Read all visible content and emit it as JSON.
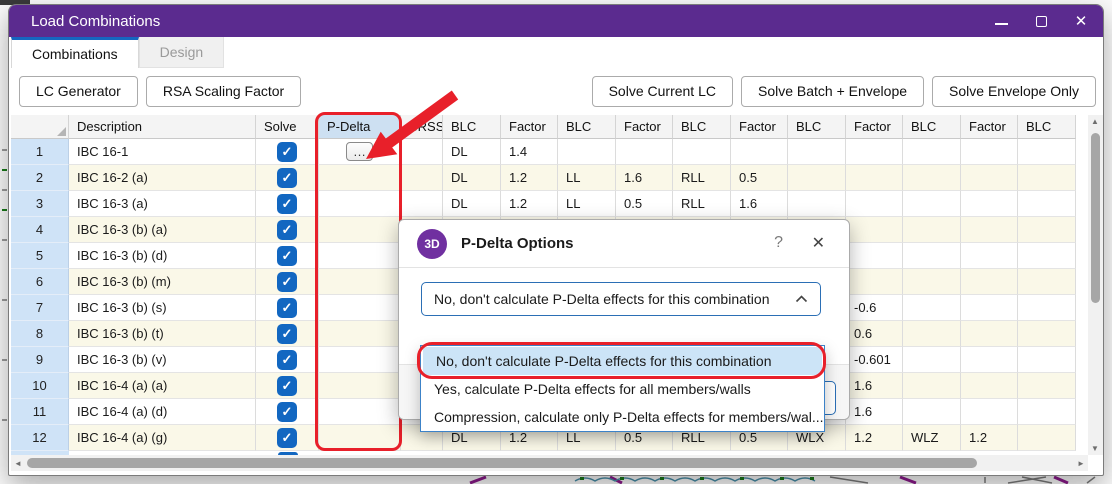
{
  "window": {
    "title": "Load Combinations"
  },
  "tabs": [
    {
      "label": "Combinations",
      "active": true
    },
    {
      "label": "Design",
      "active": false
    }
  ],
  "toolbar": {
    "left": [
      {
        "label": "LC Generator"
      },
      {
        "label": "RSA Scaling Factor"
      }
    ],
    "right": [
      {
        "label": "Solve Current LC"
      },
      {
        "label": "Solve Batch + Envelope"
      },
      {
        "label": "Solve Envelope Only"
      }
    ]
  },
  "table": {
    "headers": [
      "",
      "Description",
      "Solve",
      "P-Delta",
      "SRSS",
      "BLC",
      "Factor",
      "BLC",
      "Factor",
      "BLC",
      "Factor",
      "BLC",
      "Factor",
      "BLC",
      "Factor",
      "BLC"
    ],
    "rows": [
      {
        "num": "1",
        "description": "IBC 16-1",
        "solve": true,
        "pdelta_button": "…",
        "cells": [
          "DL",
          "1.4",
          "",
          "",
          "",
          "",
          "",
          "",
          "",
          "",
          ""
        ]
      },
      {
        "num": "2",
        "description": "IBC 16-2 (a)",
        "solve": true,
        "cells": [
          "DL",
          "1.2",
          "LL",
          "1.6",
          "RLL",
          "0.5",
          "",
          "",
          "",
          "",
          ""
        ]
      },
      {
        "num": "3",
        "description": "IBC 16-3 (a)",
        "solve": true,
        "cells": [
          "DL",
          "1.2",
          "LL",
          "0.5",
          "RLL",
          "1.6",
          "",
          "",
          "",
          "",
          ""
        ]
      },
      {
        "num": "4",
        "description": "IBC 16-3 (b) (a)",
        "solve": true,
        "cells": [
          "",
          "",
          "",
          "",
          "",
          "",
          "",
          "",
          "",
          "",
          ""
        ]
      },
      {
        "num": "5",
        "description": "IBC 16-3 (b) (d)",
        "solve": true,
        "cells": [
          "",
          "",
          "",
          "",
          "",
          "",
          "",
          "",
          "",
          "",
          ""
        ]
      },
      {
        "num": "6",
        "description": "IBC 16-3 (b) (m)",
        "solve": true,
        "cells": [
          "",
          "",
          "",
          "",
          "",
          "",
          "",
          "",
          "",
          "",
          ""
        ]
      },
      {
        "num": "7",
        "description": "IBC 16-3 (b) (s)",
        "solve": true,
        "cells": [
          "",
          "",
          "",
          "",
          "",
          "",
          "",
          "-0.6",
          "",
          "",
          ""
        ]
      },
      {
        "num": "8",
        "description": "IBC 16-3 (b) (t)",
        "solve": true,
        "cells": [
          "",
          "",
          "",
          "",
          "",
          "",
          "",
          "0.6",
          "",
          "",
          ""
        ]
      },
      {
        "num": "9",
        "description": "IBC 16-3 (b) (v)",
        "solve": true,
        "cells": [
          "",
          "",
          "",
          "",
          "",
          "",
          "",
          "-0.601",
          "",
          "",
          ""
        ]
      },
      {
        "num": "10",
        "description": "IBC 16-4 (a) (a)",
        "solve": true,
        "cells": [
          "",
          "",
          "",
          "",
          "",
          "",
          "",
          "1.6",
          "",
          "",
          ""
        ]
      },
      {
        "num": "11",
        "description": "IBC 16-4 (a) (d)",
        "solve": true,
        "cells": [
          "",
          "",
          "",
          "",
          "",
          "",
          "",
          "1.6",
          "",
          "",
          ""
        ]
      },
      {
        "num": "12",
        "description": "IBC 16-4 (a) (g)",
        "solve": true,
        "cells": [
          "DL",
          "1.2",
          "LL",
          "0.5",
          "RLL",
          "0.5",
          "WLX",
          "1.2",
          "WLZ",
          "1.2",
          ""
        ]
      }
    ]
  },
  "dialog": {
    "logo": "3D",
    "title": "P-Delta Options",
    "combobox": {
      "value": "No, don't calculate P-Delta effects for this combination"
    },
    "options": [
      {
        "label": "No, don't calculate P-Delta effects for this combination",
        "selected": true,
        "annotated": true
      },
      {
        "label": "Yes, calculate P-Delta effects for all members/walls",
        "selected": false
      },
      {
        "label": "Compression, calculate only P-Delta effects for members/wal...",
        "selected": false
      }
    ]
  },
  "icons": {
    "check": "✓",
    "ellipsis": "…",
    "close": "✕",
    "help": "?",
    "scroll_left": "◄",
    "scroll_right": "►",
    "scroll_up": "▲",
    "scroll_down": "▼"
  },
  "colors": {
    "titlebar": "#5b2b8f",
    "accent": "#1566c0",
    "checkbox": "#1267c1",
    "annotation": "#e8202a",
    "selection": "#cce4f7",
    "row_alt": "#faf8e8",
    "row_header": "#cfe3f7",
    "pdelta_header": "#cde0f2"
  }
}
